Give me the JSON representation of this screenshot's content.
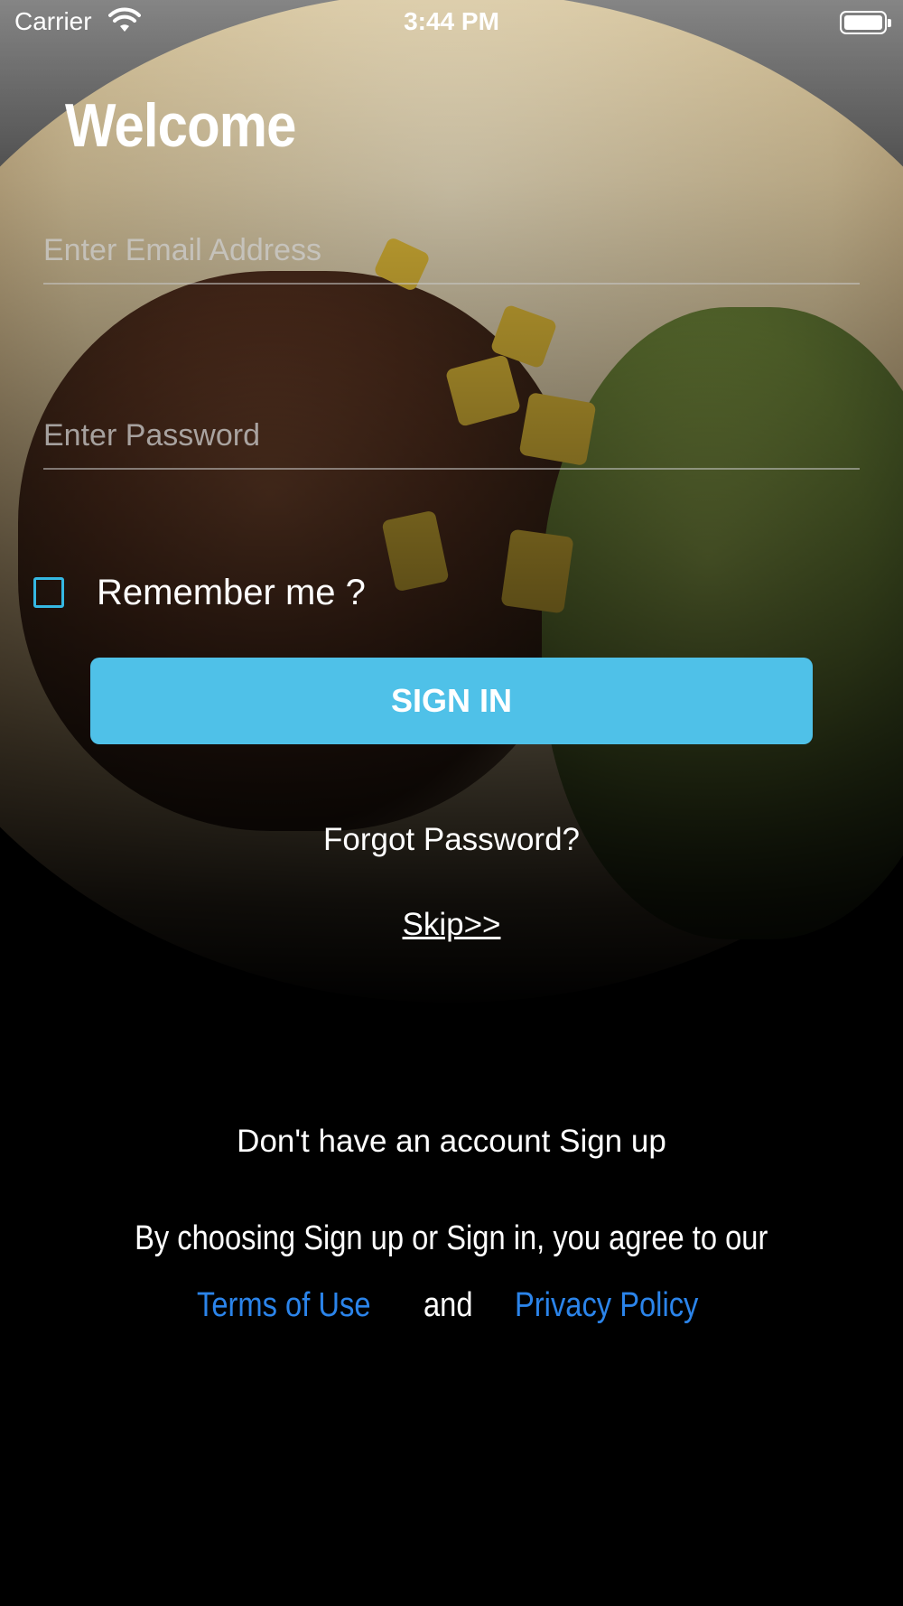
{
  "status_bar": {
    "carrier": "Carrier",
    "time": "3:44 PM"
  },
  "title": "Welcome",
  "form": {
    "email_placeholder": "Enter Email Address",
    "password_placeholder": "Enter Password",
    "remember_label": "Remember me ?",
    "remember_checked": false,
    "signin_label": "SIGN IN"
  },
  "links": {
    "forgot_password": "Forgot Password?",
    "skip": "Skip>>",
    "signup": "Don't have an account Sign up"
  },
  "legal": {
    "agree_text": "By choosing Sign up or Sign in, you agree to our",
    "terms": "Terms of Use",
    "and": "and",
    "privacy": "Privacy Policy"
  },
  "icons": {
    "wifi": "wifi-icon",
    "battery": "battery-icon",
    "checkbox": "checkbox-icon"
  },
  "colors": {
    "accent": "#4fc1e8",
    "checkbox_border": "#35b8e3",
    "link": "#2b84ea",
    "background": "#000000"
  }
}
